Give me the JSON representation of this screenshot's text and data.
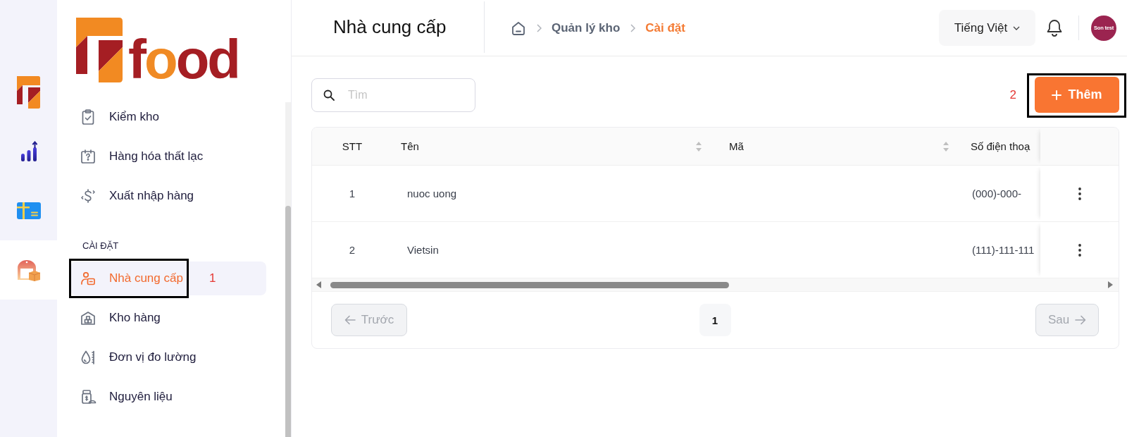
{
  "rail": {
    "items": [
      {
        "selected": false
      },
      {
        "selected": false
      },
      {
        "selected": false
      },
      {
        "selected": true
      }
    ]
  },
  "sidebar": {
    "logo": {
      "wordmark": "food"
    },
    "groups": [
      {
        "items": [
          {
            "label": "Kiểm kho",
            "selected": false
          },
          {
            "label": "Hàng hóa thất lạc",
            "selected": false
          },
          {
            "label": "Xuất nhập hàng",
            "selected": false
          }
        ]
      },
      {
        "title": "CÀI ĐẶT",
        "items": [
          {
            "label": "Nhà cung cấp",
            "selected": true,
            "callout": "1"
          },
          {
            "label": "Kho hàng",
            "selected": false
          },
          {
            "label": "Đơn vị đo lường",
            "selected": false
          },
          {
            "label": "Nguyên liệu",
            "selected": false
          }
        ]
      }
    ]
  },
  "header": {
    "title": "Nhà cung cấp",
    "breadcrumb": [
      {
        "label": "Quản lý kho",
        "current": false
      },
      {
        "label": "Cài đặt",
        "current": true
      }
    ],
    "language": "Tiếng Việt",
    "avatar": {
      "label": "Son test"
    }
  },
  "toolbar": {
    "search": {
      "placeholder": "Tìm"
    },
    "add_button": {
      "label": "Thêm",
      "callout": "2"
    }
  },
  "table": {
    "columns": [
      {
        "label": "STT",
        "sortable": false
      },
      {
        "label": "Tên",
        "sortable": true
      },
      {
        "label": "Mã",
        "sortable": true
      },
      {
        "label": "Số điện thoạ",
        "sortable": false
      }
    ],
    "rows": [
      {
        "stt": "1",
        "ten": "nuoc uong",
        "phone": "(000)-000-"
      },
      {
        "stt": "2",
        "ten": "Vietsin",
        "phone": "(111)-111-111"
      }
    ]
  },
  "pagination": {
    "previous": {
      "label": "Trước",
      "disabled": true
    },
    "pages": [
      {
        "label": "1",
        "selected": true
      }
    ],
    "next": {
      "label": "Sau",
      "disabled": true
    }
  }
}
